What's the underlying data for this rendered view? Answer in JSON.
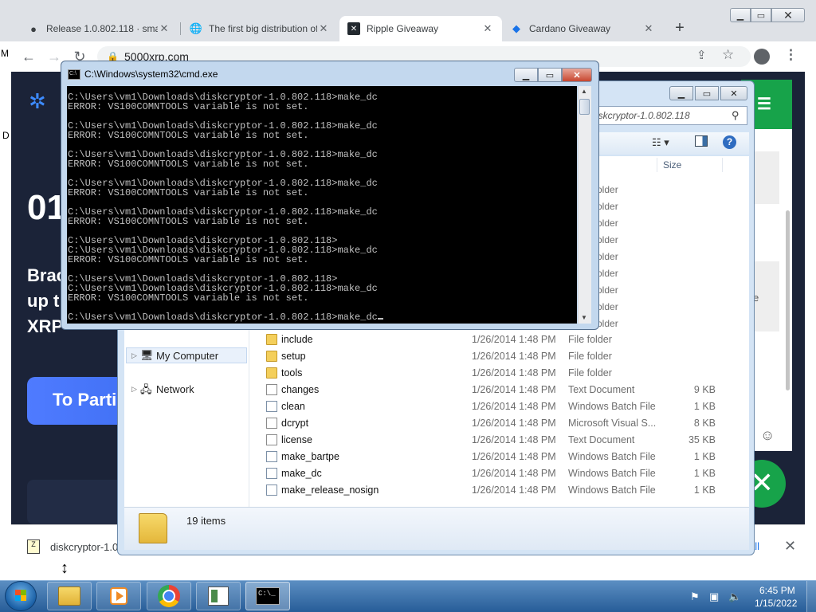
{
  "browser": {
    "tabs": [
      {
        "label": "Release 1.0.802.118 · smartc",
        "icon": "github-icon",
        "active": false
      },
      {
        "label": "The first big distribution of",
        "icon": "globe-icon",
        "active": false
      },
      {
        "label": "Ripple Giveaway",
        "icon": "ripple-icon",
        "active": true
      },
      {
        "label": "Cardano Giveaway",
        "icon": "cardano-icon",
        "active": false
      }
    ],
    "tab_close_glyph": "✕",
    "new_tab_glyph": "+",
    "url": "5000xrp.com",
    "nav": {
      "back": "←",
      "forward": "→",
      "reload": "↻"
    }
  },
  "page": {
    "heading": "01",
    "subtitle": "Brac up t XRP",
    "cta_label": "To Parti",
    "chat_side_text": "e"
  },
  "download_bar": {
    "filename": "diskcryptor-1.0",
    "show_all": "all",
    "close_glyph": "✕"
  },
  "cmd": {
    "title": "C:\\Windows\\system32\\cmd.exe",
    "lines": [
      "C:\\Users\\vm1\\Downloads\\diskcryptor-1.0.802.118>make_dc",
      "ERROR: VS100COMNTOOLS variable is not set.",
      "",
      "C:\\Users\\vm1\\Downloads\\diskcryptor-1.0.802.118>make_dc",
      "ERROR: VS100COMNTOOLS variable is not set.",
      "",
      "C:\\Users\\vm1\\Downloads\\diskcryptor-1.0.802.118>make_dc",
      "ERROR: VS100COMNTOOLS variable is not set.",
      "",
      "C:\\Users\\vm1\\Downloads\\diskcryptor-1.0.802.118>make_dc",
      "ERROR: VS100COMNTOOLS variable is not set.",
      "",
      "C:\\Users\\vm1\\Downloads\\diskcryptor-1.0.802.118>make_dc",
      "ERROR: VS100COMNTOOLS variable is not set.",
      "",
      "C:\\Users\\vm1\\Downloads\\diskcryptor-1.0.802.118>",
      "C:\\Users\\vm1\\Downloads\\diskcryptor-1.0.802.118>make_dc",
      "ERROR: VS100COMNTOOLS variable is not set.",
      "",
      "C:\\Users\\vm1\\Downloads\\diskcryptor-1.0.802.118>",
      "C:\\Users\\vm1\\Downloads\\diskcryptor-1.0.802.118>make_dc",
      "ERROR: VS100COMNTOOLS variable is not set.",
      "",
      "C:\\Users\\vm1\\Downloads\\diskcryptor-1.0.802.118>make_dc"
    ]
  },
  "explorer": {
    "search_placeholder": "iskcryptor-1.0.802.118",
    "column_size": "Size",
    "partial_type_label": "older",
    "nav": [
      {
        "label": "My Computer"
      },
      {
        "label": "Network"
      }
    ],
    "files": [
      {
        "name": "include",
        "date": "1/26/2014 1:48 PM",
        "type": "File folder",
        "size": "",
        "kind": "folder"
      },
      {
        "name": "setup",
        "date": "1/26/2014 1:48 PM",
        "type": "File folder",
        "size": "",
        "kind": "folder"
      },
      {
        "name": "tools",
        "date": "1/26/2014 1:48 PM",
        "type": "File folder",
        "size": "",
        "kind": "folder"
      },
      {
        "name": "changes",
        "date": "1/26/2014 1:48 PM",
        "type": "Text Document",
        "size": "9 KB",
        "kind": "doc"
      },
      {
        "name": "clean",
        "date": "1/26/2014 1:48 PM",
        "type": "Windows Batch File",
        "size": "1 KB",
        "kind": "bat"
      },
      {
        "name": "dcrypt",
        "date": "1/26/2014 1:48 PM",
        "type": "Microsoft Visual S...",
        "size": "8 KB",
        "kind": "doc"
      },
      {
        "name": "license",
        "date": "1/26/2014 1:48 PM",
        "type": "Text Document",
        "size": "35 KB",
        "kind": "doc"
      },
      {
        "name": "make_bartpe",
        "date": "1/26/2014 1:48 PM",
        "type": "Windows Batch File",
        "size": "1 KB",
        "kind": "bat"
      },
      {
        "name": "make_dc",
        "date": "1/26/2014 1:48 PM",
        "type": "Windows Batch File",
        "size": "1 KB",
        "kind": "bat"
      },
      {
        "name": "make_release_nosign",
        "date": "1/26/2014 1:48 PM",
        "type": "Windows Batch File",
        "size": "1 KB",
        "kind": "bat"
      }
    ],
    "status_count": "19 items"
  },
  "taskbar": {
    "time": "6:45 PM",
    "date": "1/15/2022"
  },
  "desktop": {
    "edge_glyph_1": "M",
    "edge_glyph_2": "D"
  }
}
